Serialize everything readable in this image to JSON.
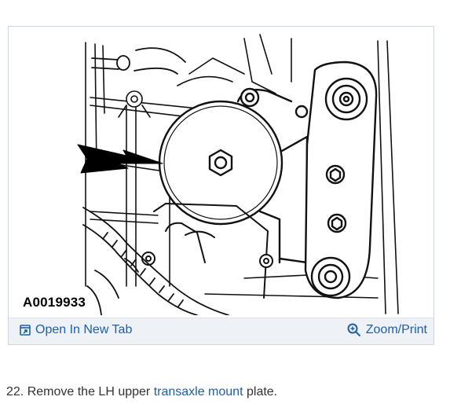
{
  "figure": {
    "id_label": "A0019933",
    "open_tab_label": "Open In New Tab",
    "zoom_print_label": "Zoom/Print",
    "icons": {
      "open_tab": "open-in-new-tab-icon",
      "zoom": "magnifier-plus-icon"
    }
  },
  "step": {
    "number": "22.",
    "text_before": "Remove the LH upper",
    "link_text": "transaxle mount",
    "text_after": "plate."
  },
  "colors": {
    "link": "#1c5fa8",
    "action_bar_bg": "#eef2f7",
    "border": "#cfd6df"
  }
}
